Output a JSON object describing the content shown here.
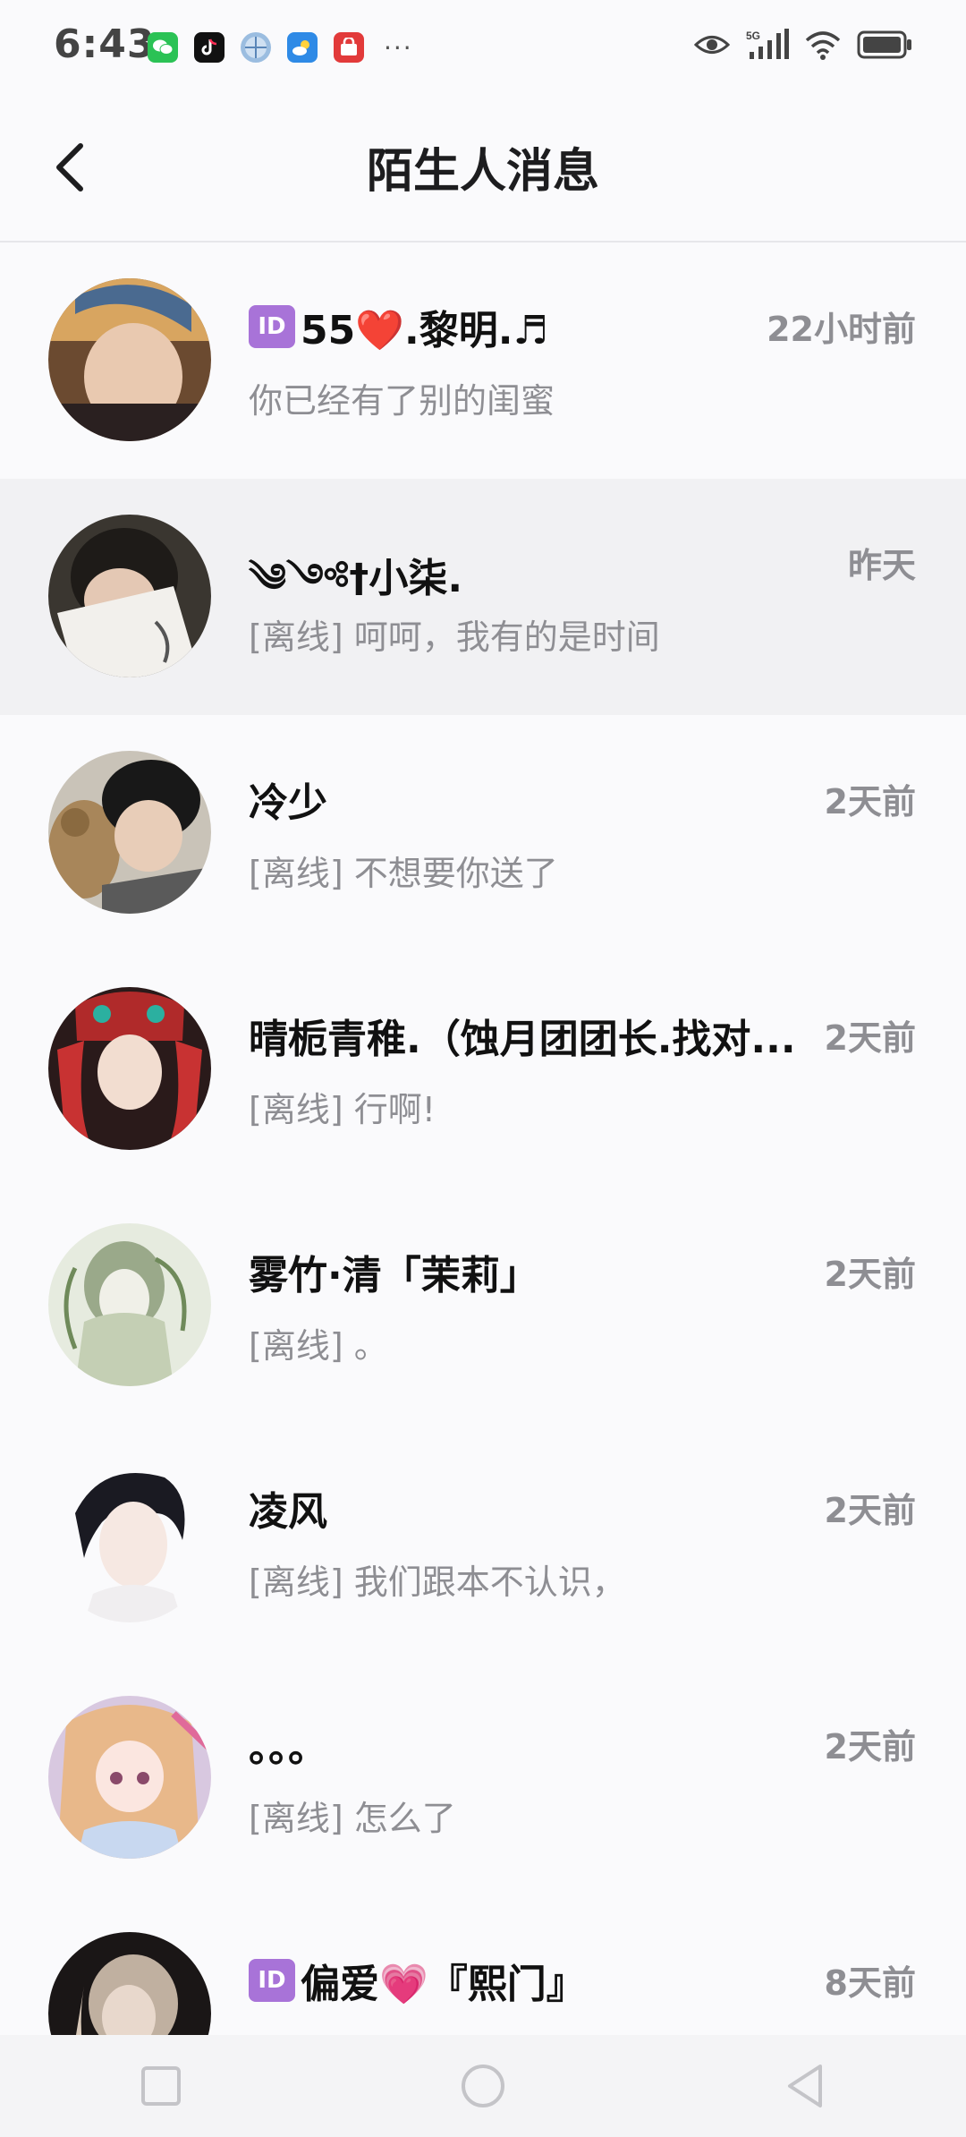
{
  "status_bar": {
    "time": "6:43",
    "apps": [
      "wechat-icon",
      "tiktok-icon",
      "ball-icon",
      "weather-icon",
      "shop-icon"
    ],
    "more": "···",
    "network": "5G",
    "icons": [
      "eye-icon",
      "signal-icon",
      "wifi-icon",
      "battery-icon"
    ]
  },
  "header": {
    "title": "陌生人消息",
    "back_icon": "chevron-left-icon"
  },
  "messages": [
    {
      "has_id_badge": true,
      "id_badge": "ID",
      "name": "55❤️.黎明.♬",
      "time": "22小时前",
      "preview": "你已经有了别的闺蜜",
      "highlight": false
    },
    {
      "has_id_badge": false,
      "name": "༄༺†小柒.",
      "time": "昨天",
      "preview": "[离线] 呵呵，我有的是时间",
      "highlight": true
    },
    {
      "has_id_badge": false,
      "name": "冷少",
      "time": "2天前",
      "preview": "[离线] 不想要你送了",
      "highlight": false
    },
    {
      "has_id_badge": false,
      "name": "晴栀青稚.（蚀月团团长.找对...",
      "time": "2天前",
      "preview": "[离线] 行啊!",
      "highlight": false
    },
    {
      "has_id_badge": false,
      "name": "雾竹·清「茉莉」",
      "time": "2天前",
      "preview": "[离线] 。",
      "highlight": false
    },
    {
      "has_id_badge": false,
      "name": "凌风",
      "time": "2天前",
      "preview": "[离线] 我们跟本不认识，",
      "highlight": false
    },
    {
      "has_id_badge": false,
      "name": "。。。",
      "time": "2天前",
      "preview": "[离线] 怎么了",
      "highlight": false
    },
    {
      "has_id_badge": true,
      "id_badge": "ID",
      "name": "偏爱💗『熙门』",
      "time": "8天前",
      "preview": "",
      "highlight": false
    }
  ],
  "nav_bar": {
    "buttons": [
      "recent-apps-icon",
      "home-icon",
      "back-icon"
    ]
  },
  "colors": {
    "background": "#fafafc",
    "highlight_row": "#f1f1f3",
    "secondary_text": "#8e8e93",
    "id_badge": "#a873d8"
  }
}
